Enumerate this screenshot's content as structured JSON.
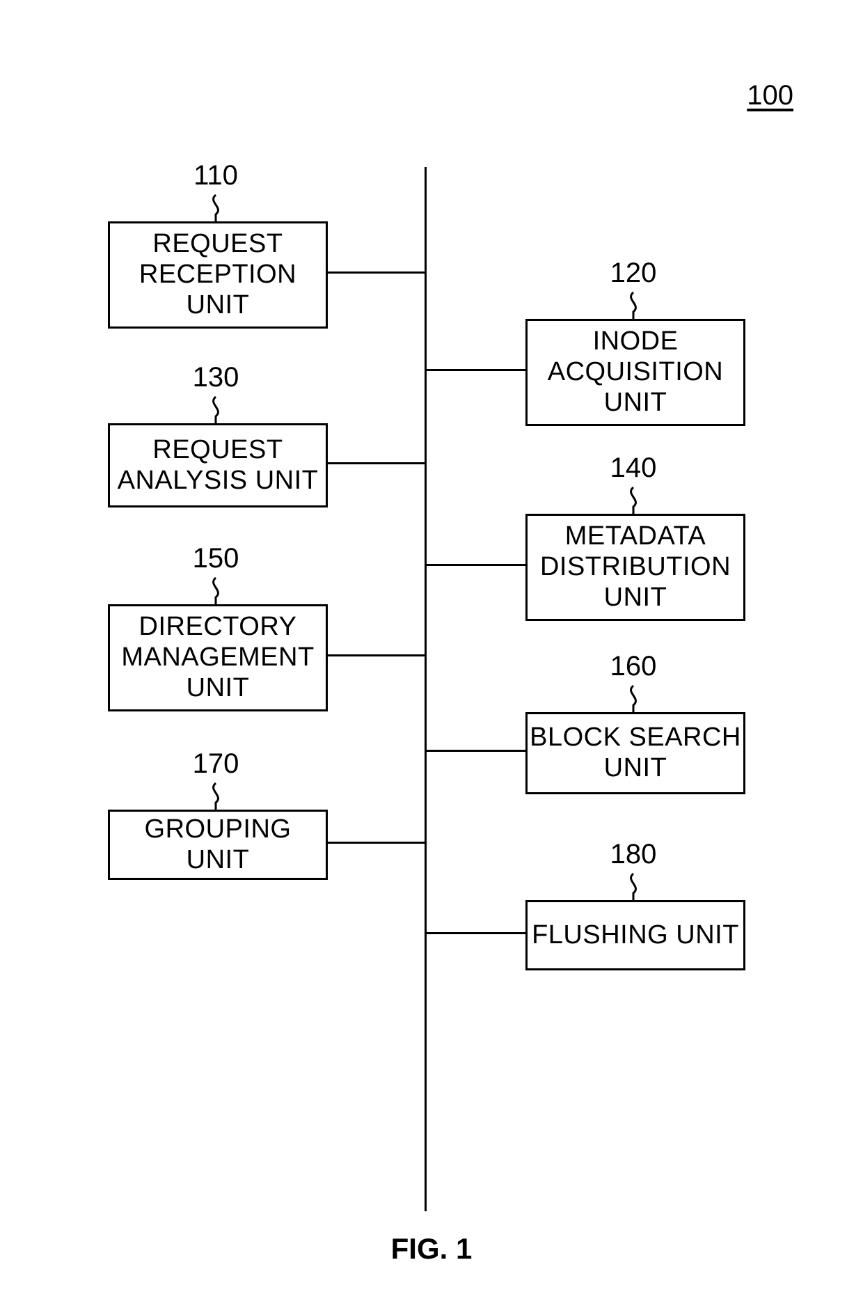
{
  "figure": {
    "main_ref": "100",
    "caption": "FIG. 1"
  },
  "blocks": {
    "b110": {
      "ref": "110",
      "label": "REQUEST\nRECEPTION\nUNIT"
    },
    "b120": {
      "ref": "120",
      "label": "INODE\nACQUISITION\nUNIT"
    },
    "b130": {
      "ref": "130",
      "label": "REQUEST\nANALYSIS UNIT"
    },
    "b140": {
      "ref": "140",
      "label": "METADATA\nDISTRIBUTION\nUNIT"
    },
    "b150": {
      "ref": "150",
      "label": "DIRECTORY\nMANAGEMENT\nUNIT"
    },
    "b160": {
      "ref": "160",
      "label": "BLOCK SEARCH\nUNIT"
    },
    "b170": {
      "ref": "170",
      "label": "GROUPING UNIT"
    },
    "b180": {
      "ref": "180",
      "label": "FLUSHING UNIT"
    }
  }
}
